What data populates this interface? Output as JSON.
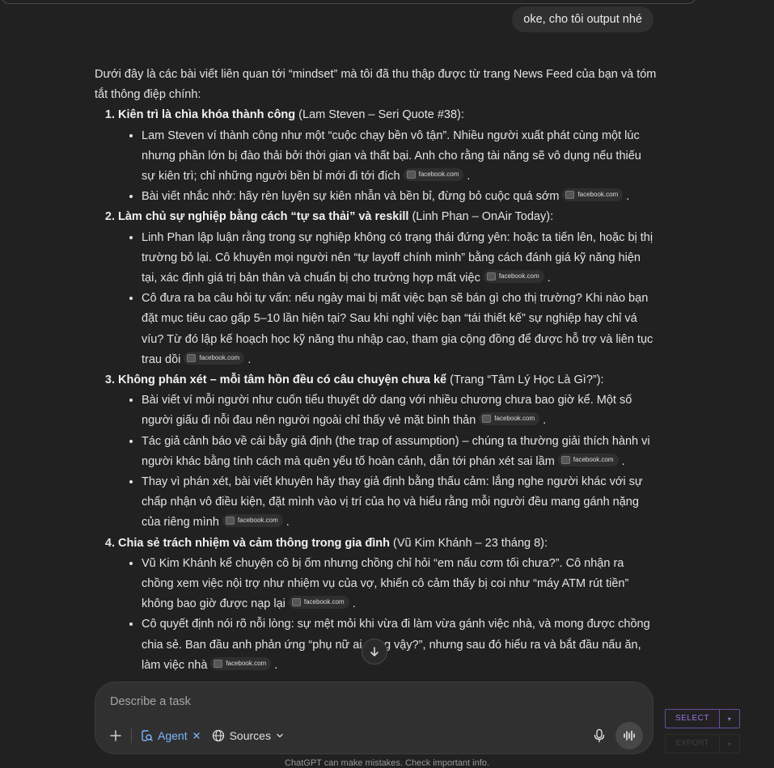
{
  "user_message": "oke, cho tôi output nhé",
  "chip_label": "facebook.com",
  "intro": "Dưới đây là các bài viết liên quan tới “mindset” mà tôi đã thu thập được từ trang News Feed của bạn và tóm tắt thông điệp chính:",
  "items": [
    {
      "title": "Kiên trì là chìa khóa thành công",
      "source": " (Lam Steven – Seri Quote #38):",
      "bullets": [
        "Lam Steven ví thành công như một “cuộc chạy bền vô tận”. Nhiều người xuất phát cùng một lúc nhưng phần lớn bị đào thải bởi thời gian và thất bại. Anh cho rằng tài năng sẽ vô dụng nếu thiếu sự kiên trì; chỉ những người bền bỉ mới đi tới đích",
        "Bài viết nhắc nhở: hãy rèn luyện sự kiên nhẫn và bền bỉ, đừng bỏ cuộc quá sớm"
      ]
    },
    {
      "title": "Làm chủ sự nghiệp bằng cách “tự sa thải” và reskill",
      "source": " (Linh Phan – OnAir Today):",
      "bullets": [
        "Linh Phan lập luận rằng trong sự nghiệp không có trạng thái đứng yên: hoặc ta tiến lên, hoặc bị thị trường bỏ lại. Cô khuyên mọi người nên “tự layoff chính mình” bằng cách đánh giá kỹ năng hiện tại, xác định giá trị bản thân và chuẩn bị cho trường hợp mất việc",
        "Cô đưa ra ba câu hỏi tự vấn: nếu ngày mai bị mất việc bạn sẽ bán gì cho thị trường? Khi nào bạn đặt mục tiêu cao gấp 5–10 lần hiện tại? Sau khi nghỉ việc bạn “tái thiết kế” sự nghiệp hay chỉ vá víu? Từ đó lập kế hoạch học kỹ năng thu nhập cao, tham gia cộng đồng để được hỗ trợ và liên tục trau dồi"
      ]
    },
    {
      "title": "Không phán xét – mỗi tâm hồn đều có câu chuyện chưa kể",
      "source": " (Trang “Tâm Lý Học Là Gì?”):",
      "bullets": [
        "Bài viết ví mỗi người như cuốn tiểu thuyết dở dang với nhiều chương chưa bao giờ kể. Một số người giấu đi nỗi đau nên người ngoài chỉ thấy vẻ mặt bình thản",
        "Tác giả cảnh báo về cái bẫy giả định (the trap of assumption) – chúng ta thường giải thích hành vi người khác bằng tính cách mà quên yếu tố hoàn cảnh, dẫn tới phán xét sai lầm",
        "Thay vì phán xét, bài viết khuyên hãy thay giả định bằng thấu cảm: lắng nghe người khác với sự chấp nhận vô điều kiện, đặt mình vào vị trí của họ và hiểu rằng mỗi người đều mang gánh nặng của riêng mình"
      ]
    },
    {
      "title": "Chia sẻ trách nhiệm và cảm thông trong gia đình",
      "source": " (Vũ Kim Khánh – 23 tháng 8):",
      "bullets": [
        "Vũ Kim Khánh kể chuyện cô bị ốm nhưng chồng chỉ hỏi “em nấu cơm tối chưa?”. Cô nhận ra chồng xem việc nội trợ như nhiệm vụ của vợ, khiến cô cảm thấy bị coi như “máy ATM rút tiền” không bao giờ được nạp lại",
        "Cô quyết định nói rõ nỗi lòng: sự mệt mỏi khi vừa đi làm vừa gánh việc nhà, và mong được chồng chia sẻ. Ban đầu anh phản ứng “phụ nữ ai cũng vậy?”, nhưng sau đó hiểu ra và bắt đầu nấu ăn, làm việc nhà"
      ]
    }
  ],
  "composer": {
    "placeholder": "Describe a task",
    "agent_label": "Agent",
    "sources_label": "Sources"
  },
  "overlay": {
    "select_label": "SELECT",
    "export_label": "EXPORT"
  },
  "footer": "ChatGPT can make mistakes. Check important info."
}
